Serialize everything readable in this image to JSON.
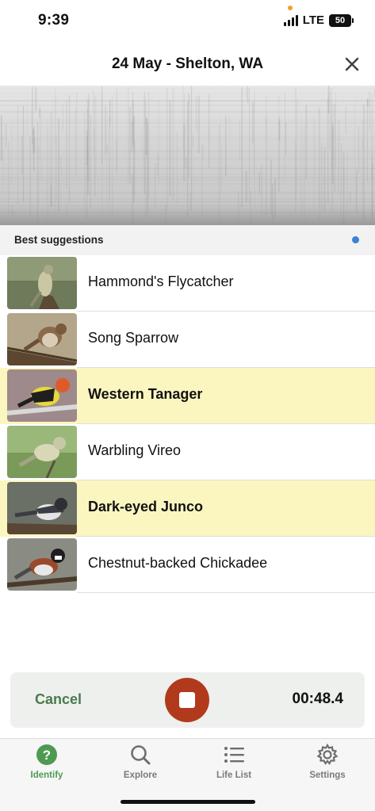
{
  "status": {
    "time": "9:39",
    "network": "LTE",
    "battery": "50"
  },
  "header": {
    "title": "24 May - Shelton, WA",
    "close_icon": "close-icon"
  },
  "suggestions": {
    "label": "Best suggestions",
    "items": [
      {
        "name": "Hammond's Flycatcher",
        "highlighted": false,
        "thumb": "hammonds-flycatcher-photo"
      },
      {
        "name": "Song Sparrow",
        "highlighted": false,
        "thumb": "song-sparrow-photo"
      },
      {
        "name": "Western Tanager",
        "highlighted": true,
        "thumb": "western-tanager-photo"
      },
      {
        "name": "Warbling Vireo",
        "highlighted": false,
        "thumb": "warbling-vireo-photo"
      },
      {
        "name": "Dark-eyed Junco",
        "highlighted": true,
        "thumb": "dark-eyed-junco-photo"
      },
      {
        "name": "Chestnut-backed Chickadee",
        "highlighted": false,
        "thumb": "chestnut-backed-chickadee-photo"
      }
    ]
  },
  "recording": {
    "cancel_label": "Cancel",
    "stop_icon": "stop-icon",
    "elapsed": "00:48.4"
  },
  "tabs": [
    {
      "label": "Identify",
      "icon": "question-icon",
      "active": true
    },
    {
      "label": "Explore",
      "icon": "search-icon",
      "active": false
    },
    {
      "label": "Life List",
      "icon": "list-icon",
      "active": false
    },
    {
      "label": "Settings",
      "icon": "gear-icon",
      "active": false
    }
  ],
  "colors": {
    "highlight": "#fbf6c0",
    "accent_green": "#4f9a52",
    "stop_red": "#b23a1c",
    "indicator_blue": "#3b82d6"
  }
}
